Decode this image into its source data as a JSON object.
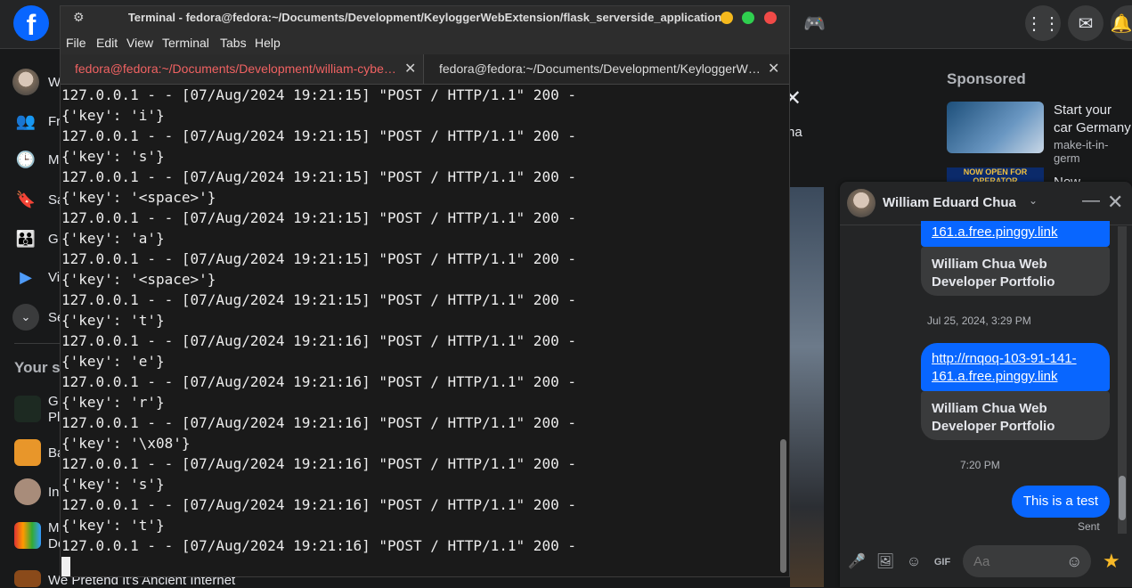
{
  "facebook": {
    "logo": "f",
    "top_icons": [
      "apps-icon",
      "messenger-icon",
      "notifications-icon"
    ],
    "nav": [
      {
        "label": "W",
        "icon": "profile-avatar"
      },
      {
        "label": "Fr",
        "icon": "friends-icon"
      },
      {
        "label": "M",
        "icon": "memories-icon"
      },
      {
        "label": "Sa",
        "icon": "saved-icon"
      },
      {
        "label": "G",
        "icon": "groups-icon"
      },
      {
        "label": "Vi",
        "icon": "video-icon"
      },
      {
        "label": "Se",
        "icon": "chevron-down-icon"
      }
    ],
    "shortcuts_title": "Your s",
    "shortcuts": [
      {
        "label": "G\nPl"
      },
      {
        "label": "Ba"
      },
      {
        "label": "In"
      },
      {
        "label": "M\nDe"
      },
      {
        "label": "We Pretend It's Ancient Internet"
      }
    ],
    "center_text": "na",
    "sponsored_title": "Sponsored",
    "ads": [
      {
        "title": "Start your car Germany",
        "url": "make-it-in-germ"
      },
      {
        "title": "Now accepting",
        "image_text": "NOW OPEN FOR OPERATOR"
      }
    ]
  },
  "messenger": {
    "contact_name": "William Eduard Chua",
    "messages": [
      {
        "link": "161.a.free.pinggy.link",
        "card_title": "William Chua Web Developer Portfolio"
      },
      {
        "timestamp": "Jul 25, 2024, 3:29 PM"
      },
      {
        "link": "http://rnqoq-103-91-141-161.a.free.pinggy.link",
        "card_title": "William Chua Web Developer Portfolio"
      },
      {
        "timestamp": "7:20 PM"
      },
      {
        "text": "This is a test",
        "status": "Sent"
      }
    ],
    "input_placeholder": "Aa"
  },
  "terminal": {
    "title": "Terminal - fedora@fedora:~/Documents/Development/KeyloggerWebExtension/flask_serverside_application",
    "menu": [
      "File",
      "Edit",
      "View",
      "Terminal",
      "Tabs",
      "Help"
    ],
    "tabs": [
      {
        "label": "fedora@fedora:~/Documents/Development/william-cybe…",
        "active": true
      },
      {
        "label": "fedora@fedora:~/Documents/Development/KeyloggerW…",
        "active": false
      }
    ],
    "lines": [
      "127.0.0.1 - - [07/Aug/2024 19:21:15] \"POST / HTTP/1.1\" 200 -",
      "{'key': 'i'}",
      "127.0.0.1 - - [07/Aug/2024 19:21:15] \"POST / HTTP/1.1\" 200 -",
      "{'key': 's'}",
      "127.0.0.1 - - [07/Aug/2024 19:21:15] \"POST / HTTP/1.1\" 200 -",
      "{'key': '<space>'}",
      "127.0.0.1 - - [07/Aug/2024 19:21:15] \"POST / HTTP/1.1\" 200 -",
      "{'key': 'a'}",
      "127.0.0.1 - - [07/Aug/2024 19:21:15] \"POST / HTTP/1.1\" 200 -",
      "{'key': '<space>'}",
      "127.0.0.1 - - [07/Aug/2024 19:21:15] \"POST / HTTP/1.1\" 200 -",
      "{'key': 't'}",
      "127.0.0.1 - - [07/Aug/2024 19:21:16] \"POST / HTTP/1.1\" 200 -",
      "{'key': 'e'}",
      "127.0.0.1 - - [07/Aug/2024 19:21:16] \"POST / HTTP/1.1\" 200 -",
      "{'key': 'r'}",
      "127.0.0.1 - - [07/Aug/2024 19:21:16] \"POST / HTTP/1.1\" 200 -",
      "{'key': '\\x08'}",
      "127.0.0.1 - - [07/Aug/2024 19:21:16] \"POST / HTTP/1.1\" 200 -",
      "{'key': 's'}",
      "127.0.0.1 - - [07/Aug/2024 19:21:16] \"POST / HTTP/1.1\" 200 -",
      "{'key': 't'}",
      "127.0.0.1 - - [07/Aug/2024 19:21:16] \"POST / HTTP/1.1\" 200 -"
    ],
    "colors": {
      "minimize": "#f5b91d",
      "maximize": "#2fcf4f",
      "close": "#f04a47",
      "active_tab_text": "#f06262"
    }
  }
}
